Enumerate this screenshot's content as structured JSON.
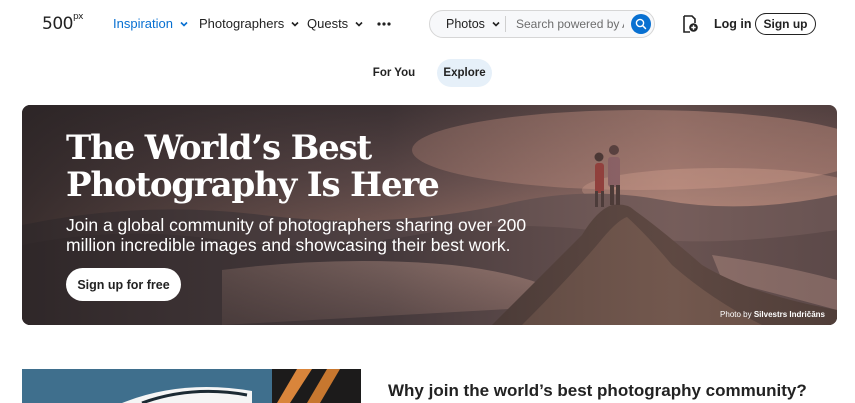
{
  "header": {
    "logo_text": "500",
    "logo_sup": "px",
    "nav": [
      {
        "label": "Inspiration",
        "active": true
      },
      {
        "label": "Photographers",
        "active": false
      },
      {
        "label": "Quests",
        "active": false
      }
    ],
    "more_icon": "more-dots-icon",
    "search": {
      "type_label": "Photos",
      "placeholder": "Search powered by AI",
      "icon": "search-icon"
    },
    "upload_icon": "upload-icon",
    "login_label": "Log in",
    "signup_label": "Sign up"
  },
  "tabs": [
    {
      "label": "For You",
      "active": false
    },
    {
      "label": "Explore",
      "active": true
    }
  ],
  "hero": {
    "title": "The World’s Best Photography Is Here",
    "subtitle": "Join a global community of photographers sharing over 200 million incredible images and showcasing their best work.",
    "cta_label": "Sign up for free",
    "credit_prefix": "Photo by",
    "credit_name": "Silvestrs Indričāns"
  },
  "section": {
    "heading": "Why join the world’s best photography community?"
  },
  "colors": {
    "accent": "#0870d1",
    "tab_active_bg": "#e6f0f9"
  }
}
